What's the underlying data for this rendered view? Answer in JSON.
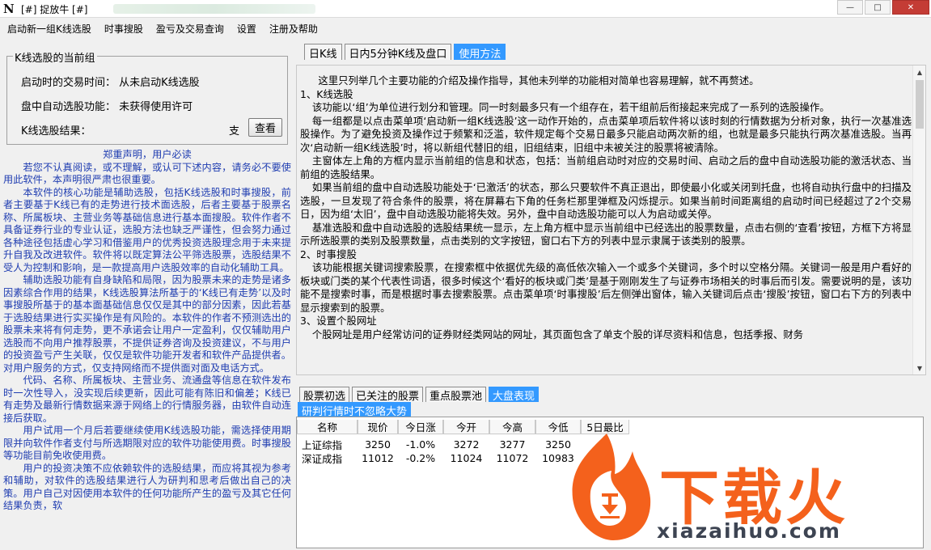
{
  "window": {
    "title": "[#] 捉放牛 [#]",
    "logo_glyph": "N",
    "minimize_glyph": "—",
    "maximize_glyph": "□",
    "close_glyph": "✕"
  },
  "menu": {
    "items": [
      "启动新一组K线选股",
      "时事搜股",
      "盈亏及交易查询",
      "设置",
      "注册及帮助"
    ]
  },
  "group": {
    "legend": "K线选股的当前组",
    "start_time_label": "启动时的交易时间：",
    "start_time_value": "从未启动K线选股",
    "auto_label": "盘中自动选股功能：",
    "auto_value": "未获得使用许可",
    "result_label": "K线选股结果：",
    "result_count": "支",
    "view_button": "查看"
  },
  "disclaimer": {
    "title": "郑重声明，用户必读",
    "paragraphs": [
      "若您不认真阅读，或不理解，或认可下述内容，请务必不要使用此软件，本声明很严肃也很重要。",
      "本软件的核心功能是辅助选股，包括K线选股和时事搜股，前者主要基于K线已有的走势进行技术面选股，后者主要基于股票名称、所属板块、主营业务等基础信息进行基本面搜股。软件作者不具备证券行业的专业认证，选股方法也缺乏严谨性，但会努力通过各种途径包括虚心学习和借鉴用户的优秀投资选股理念用于未来提升自我及改进软件。软件将以既定算法公平筛选股票，选股结果不受人为控制和影响，是一款提高用户选股效率的自动化辅助工具。",
      "辅助选股功能有自身缺陷和局限，因为股票未来的走势是诸多因素综合作用的结果，K线选股算法所基于的‘K线已有走势’以及时事搜股所基于的基本面基础信息仅仅是其中的部分因素，因此若基于选股结果进行实买操作是有风险的。本软件的作者不预测选出的股票未来将有何走势，更不承诺会让用户一定盈利，仅仅辅助用户选股而不向用户推荐股票，不提供证券咨询及投资建议，不与用户的投资盈亏产生关联，仅仅是软件功能开发者和软件产品提供者。对用户服务的方式，仅支持网络而不提供面对面及电话方式。",
      "代码、名称、所属板块、主营业务、流通盘等信息在软件发布时一次性导入，没实现后续更新，因此可能有陈旧和偏差；K线已有走势及最新行情数据来源于网络上的行情服务器，由软件自动连接后获取。",
      "用户试用一个月后若要继续使用K线选股功能，需选择使用期限并向软件作者支付与所选期限对应的软件功能使用费。时事搜股等功能目前免收使用费。",
      "用户的投资决策不应依赖软件的选股结果，而应将其视为参考和辅助，对软件的选股结果进行人为研判和思考后做出自己的决策。用户自己对因使用本软件的任何功能所产生的盈亏及其它任何结果负责，软"
    ]
  },
  "top_tabs": [
    "日K线",
    "日内5分钟K线及盘口",
    "使用方法"
  ],
  "help": {
    "lines": [
      "这里只列举几个主要功能的介绍及操作指导，其他未列举的功能相对简单也容易理解，就不再赘述。",
      "1、K线选股",
      "该功能以‘组’为单位进行划分和管理。同一时刻最多只有一个组存在，若干组前后衔接起来完成了一系列的选股操作。",
      "每一组都是以点击菜单项‘启动新一组K线选股’这一动作开始的，点击菜单项后软件将以该时刻的行情数据为分析对象，执行一次基准选股操作。为了避免投资及操作过于频繁和泛滥，软件规定每个交易日最多只能启动两次新的组，也就是最多只能执行两次基准选股。当再次‘启动新一组K线选股’时，将以新组代替旧的组，旧组结束，旧组中未被关注的股票将被清除。",
      "主窗体左上角的方框内显示当前组的信息和状态，包括：当前组启动时对应的交易时间、启动之后的盘中自动选股功能的激活状态、当前组的选股结果。",
      "如果当前组的盘中自动选股功能处于‘已激活’的状态，那么只要软件不真正退出，即使最小化或关闭到托盘，也将自动执行盘中的扫描及选股，一旦发现了符合条件的股票，将在屏幕右下角的任务栏那里弹框及闪烁提示。如果当前时间距离组的启动时间已经超过了2个交易日，因为组‘太旧’，盘中自动选股功能将失效。另外，盘中自动选股功能可以人为启动或关停。",
      "基准选股和盘中自动选股的选股结果统一显示，左上角方框中显示当前组中已经选出的股票数量，点击右侧的‘查看’按钮，方框下方将显示所选股票的类别及股票数量，点击类别的文字按钮，窗口右下方的列表中显示隶属于该类别的股票。",
      "2、时事搜股",
      "该功能根据关键词搜索股票，在搜索框中依据优先级的高低依次输入一个或多个关键词，多个时以空格分隔。关键词一般是用户看好的板块或门类的某个代表性词语，很多时候这个‘看好的板块或门类’是基于刚刚发生了与证券市场相关的时事后而引发。需要说明的是，该功能不是搜索时事，而是根据时事去搜索股票。点击菜单项‘时事搜股’后左侧弹出窗体，输入关键词后点击‘搜股’按钮，窗口右下方的列表中显示搜索到的股票。",
      "3、设置个股网址",
      "个股网址是用户经常访问的证券财经类网站的网址，其页面包含了单支个股的详尽资料和信息，包括季报、财务"
    ]
  },
  "bottom_tabs": [
    "股票初选",
    "已关注的股票",
    "重点股票池",
    "大盘表现"
  ],
  "sub_tab": "研判行情时不忽略大势",
  "market_table": {
    "columns": [
      "名称",
      "现价",
      "今日涨",
      "今开",
      "今高",
      "今低",
      "5日最比"
    ],
    "rows": [
      [
        "上证综指",
        "3250",
        "-1.0%",
        "3272",
        "3277",
        "3250",
        ""
      ],
      [
        "深证成指",
        "11012",
        "-0.2%",
        "11024",
        "11072",
        "10983",
        ""
      ]
    ]
  },
  "watermark": {
    "word": "下载火",
    "url": "xiazaihuo.com",
    "brand_color": "#f4611c",
    "accent_color": "#f4611c"
  }
}
